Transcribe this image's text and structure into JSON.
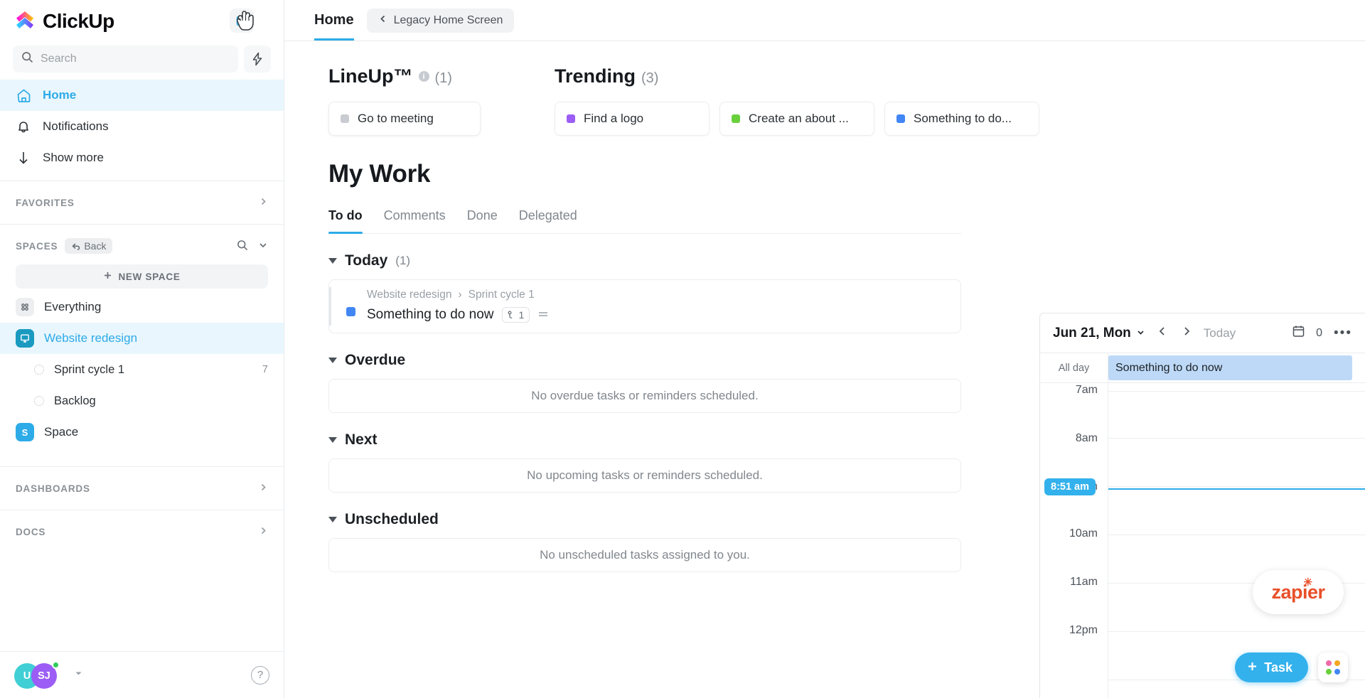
{
  "brand": {
    "name": "ClickUp",
    "accent": "#2dabe8"
  },
  "sidebar": {
    "search": {
      "placeholder": "Search",
      "icon": "search-icon"
    },
    "bolt_icon": "lightning-bolt-icon",
    "nav": [
      {
        "label": "Home",
        "icon": "home-icon",
        "active": true
      },
      {
        "label": "Notifications",
        "icon": "bell-icon",
        "active": false
      },
      {
        "label": "Show more",
        "icon": "arrow-down-icon",
        "active": false
      }
    ],
    "favorites": {
      "label": "FAVORITES",
      "chevron": "chevron-right-icon"
    },
    "spaces": {
      "label": "SPACES",
      "back_label": "Back",
      "search_icon": "search-icon",
      "chevron_icon": "chevron-down-icon",
      "new_space_label": "NEW SPACE",
      "items": [
        {
          "label": "Everything",
          "icon": "grid-icon",
          "kind": "everything",
          "active": false
        },
        {
          "label": "Website redesign",
          "icon": "monitor-icon",
          "color": "#1a9ac0",
          "kind": "space",
          "active": true
        },
        {
          "label": "Sprint cycle 1",
          "kind": "list",
          "count": "7"
        },
        {
          "label": "Backlog",
          "kind": "list",
          "count": ""
        },
        {
          "label": "Space",
          "initial": "S",
          "color": "#2dabe8",
          "kind": "space",
          "active": false
        }
      ]
    },
    "dashboards": {
      "label": "DASHBOARDS",
      "chevron": "chevron-right-icon"
    },
    "docs": {
      "label": "DOCS",
      "chevron": "chevron-right-icon"
    },
    "footer": {
      "avatar1": "U",
      "avatar2": "SJ",
      "avatar_chevron": "chevron-down-icon",
      "help_label": "?"
    }
  },
  "topbar": {
    "tab_label": "Home",
    "legacy_label": "Legacy Home Screen",
    "legacy_back_icon": "chevron-left-icon",
    "collapse_icon": "sidebar-collapse-icon",
    "cursor_icon": "mouse-cursor-icon"
  },
  "lineup": {
    "title": "LineUp™",
    "info_icon": "info-icon",
    "count": "(1)",
    "card": {
      "label": "Go to meeting",
      "color": "#c9ccd0"
    }
  },
  "trending": {
    "title": "Trending",
    "count": "(3)",
    "cards": [
      {
        "label": "Find a logo",
        "color": "#9b5df5"
      },
      {
        "label": "Create an about ...",
        "color": "#69d03c"
      },
      {
        "label": "Something to do...",
        "color": "#4286f5"
      }
    ]
  },
  "my_work": {
    "title": "My Work",
    "tabs": [
      {
        "label": "To do",
        "active": true
      },
      {
        "label": "Comments",
        "active": false
      },
      {
        "label": "Done",
        "active": false
      },
      {
        "label": "Delegated",
        "active": false
      }
    ],
    "groups": [
      {
        "title": "Today",
        "count": "(1)"
      },
      {
        "title": "Overdue",
        "count": "",
        "empty": "No overdue tasks or reminders scheduled."
      },
      {
        "title": "Next",
        "count": "",
        "empty": "No upcoming tasks or reminders scheduled."
      },
      {
        "title": "Unscheduled",
        "count": "",
        "empty": "No unscheduled tasks assigned to you."
      }
    ],
    "today_task": {
      "breadcrumb_space": "Website redesign",
      "breadcrumb_sep": "›",
      "breadcrumb_list": "Sprint cycle 1",
      "name": "Something to do now",
      "subtask_count": "1",
      "subtask_icon": "subtask-icon",
      "priority_icon": "priority-icon",
      "dot_color": "#4286f5"
    }
  },
  "calendar": {
    "date_label": "Jun 21, Mon",
    "date_chevron": "chevron-down-icon",
    "prev_icon": "chevron-left-icon",
    "next_icon": "chevron-right-icon",
    "today_label": "Today",
    "calendar_icon": "calendar-icon",
    "event_count": "0",
    "more_icon": "more-horizontal-icon",
    "all_day_label": "All day",
    "all_day_event": "Something to do now",
    "now_time": "8:51 am",
    "hours": [
      "7am",
      "8am",
      "9am",
      "10am",
      "11am",
      "12pm"
    ]
  },
  "overlays": {
    "zapier_label": "zapier",
    "fab_task_label": "Task",
    "fab_plus_icon": "plus-icon",
    "fab_apps_icon": "apps-grid-icon"
  }
}
